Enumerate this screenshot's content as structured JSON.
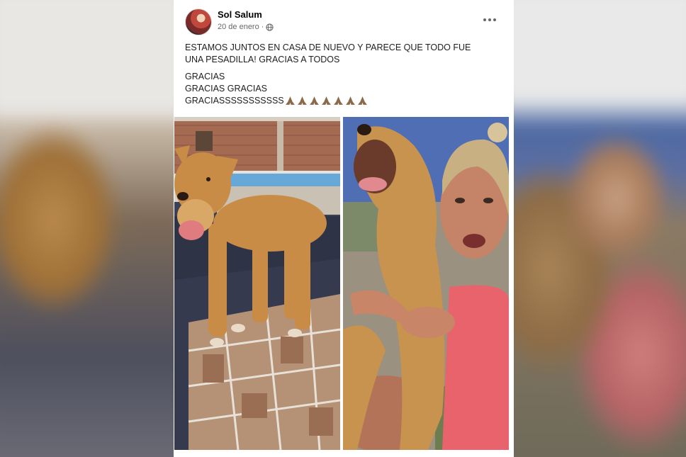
{
  "post": {
    "author": "Sol Salum",
    "date": "20 de enero",
    "separator": "·",
    "visibility_icon": "globe-icon",
    "more_icon": "more-options-icon",
    "text_line1": "ESTAMOS JUNTOS EN CASA DE NUEVO Y PARECE QUE TODO FUE",
    "text_line2": "UNA PESADILLA! GRACIAS A TODOS",
    "thanks1": "GRACIAS",
    "thanks2": "GRACIAS GRACIAS",
    "thanks3": "GRACIASSSSSSSSSSS",
    "emoji_icon": "praying-hands-icon",
    "emoji_count": 7
  },
  "colors": {
    "card": "#ffffff",
    "text": "#1c1e21",
    "secondary": "#65676b"
  }
}
